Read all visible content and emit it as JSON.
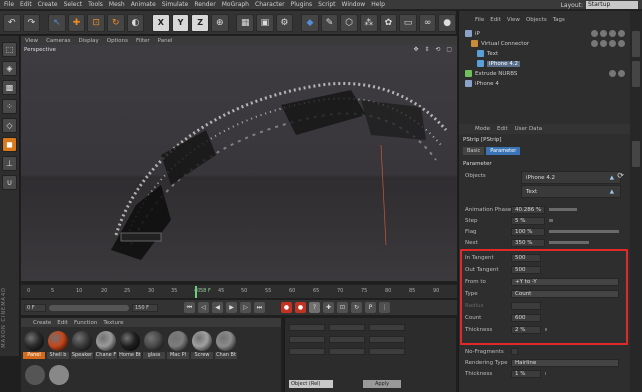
{
  "app": {
    "menu": [
      "File",
      "Edit",
      "Create",
      "Select",
      "Tools",
      "Mesh",
      "Animate",
      "Simulate",
      "Render",
      "MoGraph",
      "Character",
      "Plugins",
      "Script",
      "Window",
      "Help"
    ],
    "layout_label": "Layout:",
    "layout_value": "Startup"
  },
  "toolbar": {
    "buttons": [
      "undo",
      "redo",
      "select",
      "move",
      "scale",
      "rotate",
      "recent",
      "X",
      "Y",
      "Z",
      "coord",
      "render-view",
      "render",
      "render-settings",
      "cube",
      "pen",
      "subdivide",
      "array",
      "mograph",
      "deformer",
      "scene",
      "camera",
      "light"
    ]
  },
  "viewport": {
    "menu": [
      "View",
      "Cameras",
      "Display",
      "Options",
      "Filter",
      "Panel"
    ],
    "label": "Perspective"
  },
  "timeline": {
    "ticks": [
      "0",
      "5",
      "10",
      "20",
      "25",
      "30",
      "35",
      "40",
      "45",
      "50",
      "55",
      "60",
      "65",
      "70",
      "75",
      "80",
      "85",
      "90"
    ],
    "current_frame": "58 F",
    "start_field": "0 F",
    "end_field": "150 F"
  },
  "materials": {
    "menu": [
      "Create",
      "Edit",
      "Function",
      "Texture"
    ],
    "items": [
      {
        "name": "Panel",
        "color": "#2a2a2a",
        "selected": true
      },
      {
        "name": "Shell b",
        "color": "#c4471c",
        "selected": false
      },
      {
        "name": "Speaker",
        "color": "#3a3a3a",
        "selected": false
      },
      {
        "name": "Chane F",
        "color": "#9a9a9a",
        "selected": false
      },
      {
        "name": "Home Bt",
        "color": "#202020",
        "selected": false
      },
      {
        "name": "glass",
        "color": "#4a4a4a",
        "selected": false
      },
      {
        "name": "Mac Pl",
        "color": "#7d7d7d",
        "selected": false
      },
      {
        "name": "Screw",
        "color": "#a0a0a0",
        "selected": false
      },
      {
        "name": "Chan Bt",
        "color": "#8c8c8c",
        "selected": false
      }
    ]
  },
  "coordinates": {
    "mode": "Object (Rel)",
    "apply": "Apply"
  },
  "objects": {
    "menu": [
      "File",
      "Edit",
      "View",
      "Objects",
      "Tags"
    ],
    "rows": [
      {
        "name": "iP",
        "color": "#8aa2c8"
      },
      {
        "name": "Virtual Connector",
        "color": "#c98b3a"
      },
      {
        "name": "Text",
        "color": "#5aa0d8"
      },
      {
        "name": "iPhone 4.2",
        "color": "#5aa0d8",
        "highlight": true
      },
      {
        "name": "Extrude NURBS",
        "color": "#6fbf5a"
      },
      {
        "name": "iPhone 4",
        "color": "#8aa2c8"
      }
    ]
  },
  "attributes": {
    "menu": [
      "Mode",
      "Edit",
      "User Data"
    ],
    "title": "PStrip [PStrip]",
    "tabs": [
      "Basic",
      "Parameter"
    ],
    "section": "Parameter",
    "objects_label": "Objects",
    "links": [
      "iPhone 4.2",
      "Text"
    ],
    "params": [
      {
        "label": "Animation Phase",
        "value": "40.286 %",
        "bar": 0.4
      },
      {
        "label": "Step",
        "value": "5 %",
        "bar": 0.05
      },
      {
        "label": "Flag",
        "value": "100 %",
        "bar": 1.0
      },
      {
        "label": "Next",
        "value": "350 %",
        "bar": 0.55
      },
      {
        "label": "In Tangent",
        "value": "500",
        "bar": null
      },
      {
        "label": "Out Tangent",
        "value": "500",
        "bar": null
      },
      {
        "label": "From to",
        "value": "+Y to -Y",
        "bar": null
      },
      {
        "label": "Type",
        "value": "Count",
        "bar": null
      },
      {
        "label": "Radius",
        "value": "",
        "bar": null
      },
      {
        "label": "Count",
        "value": "600",
        "bar": null
      },
      {
        "label": "Thickness",
        "value": "2 %",
        "bar": 0.02
      },
      {
        "label": "No-Fragments",
        "value": "",
        "bar": null
      },
      {
        "label": "Rendering Type",
        "value": "Hairline",
        "bar": null
      },
      {
        "label": "Thickness",
        "value": "1 %",
        "bar": 0.01
      }
    ]
  },
  "colors": {
    "accent": "#d26a1e",
    "highlight_box": "#e02a2a",
    "selection": "#3a74b5"
  }
}
